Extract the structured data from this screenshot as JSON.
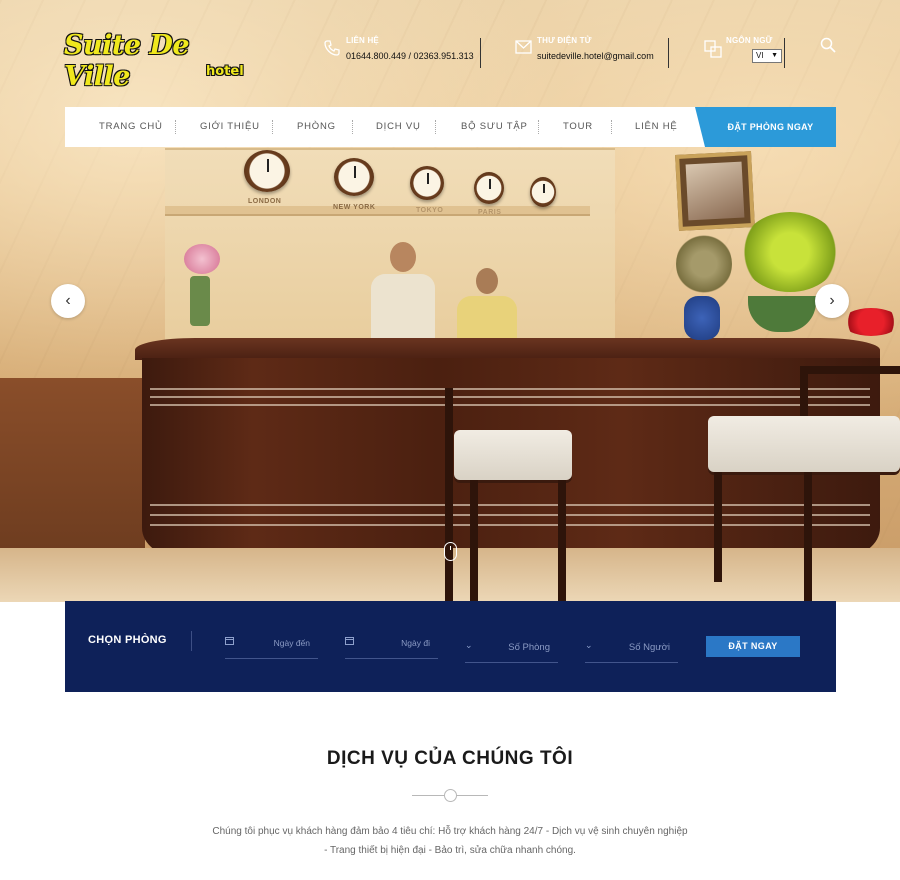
{
  "header": {
    "logo_text": "Suite De Ville",
    "logo_sub": "hotel",
    "contact": {
      "label": "LIÊN HỆ",
      "value": "01644.800.449 / 02363.951.313"
    },
    "email": {
      "label": "THƯ ĐIỆN TỬ",
      "value": "suitedeville.hotel@gmail.com"
    },
    "language": {
      "label": "NGÔN NGỮ",
      "selected": "VI"
    }
  },
  "nav": {
    "items": [
      "TRANG CHỦ",
      "GIỚI THIỆU",
      "PHÒNG",
      "DỊCH VỤ",
      "BỘ SƯU TẬP",
      "TOUR",
      "LIÊN HỆ"
    ],
    "cta": "ĐẶT PHÒNG NGAY"
  },
  "hero": {
    "prev": "‹",
    "next": "›",
    "clock_labels": [
      "LONDON",
      "NEW YORK",
      "TOKYO",
      "PARIS"
    ]
  },
  "booking": {
    "title": "CHỌN PHÒNG",
    "checkin_placeholder": "Ngày đến",
    "checkout_placeholder": "Ngày đi",
    "rooms_placeholder": "Số Phòng",
    "guests_placeholder": "Số Người",
    "submit": "ĐẶT NGAY"
  },
  "services": {
    "title": "DỊCH VỤ CỦA CHÚNG TÔI",
    "description": "Chúng tôi phục vụ khách hàng đảm bảo 4 tiêu chí: Hỗ trợ khách hàng 24/7 - Dịch vụ vệ sinh chuyên nghiệp - Trang thiết bị hiện đại - Bảo trì, sửa chữa nhanh chóng."
  },
  "colors": {
    "nav_cta": "#2c9ad9",
    "booking_bg": "#0e2159",
    "booking_button": "#2b78c6",
    "logo_yellow": "#f0e81d"
  }
}
